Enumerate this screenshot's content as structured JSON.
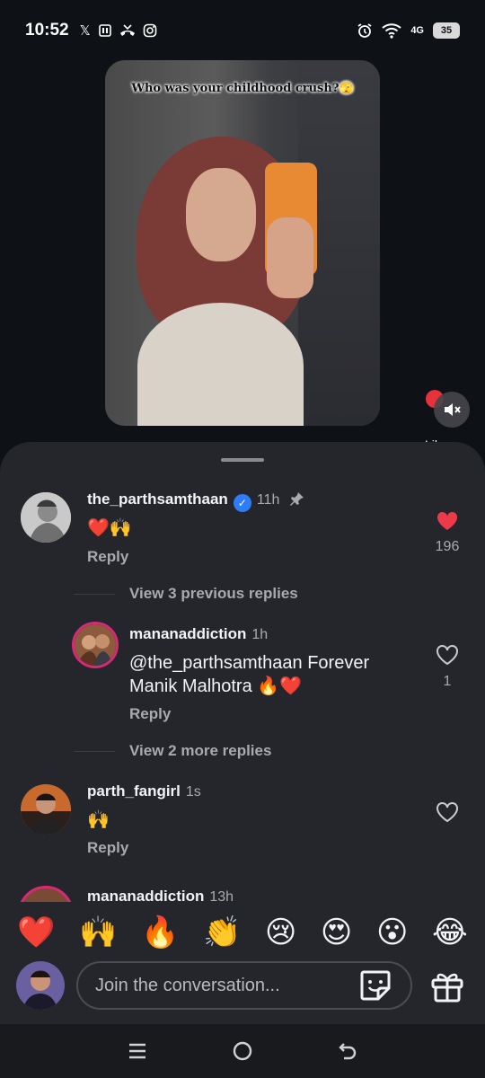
{
  "status_bar": {
    "time": "10:52",
    "left_icons": [
      "x-icon",
      "sim-icon",
      "missed-call-icon",
      "instagram-icon"
    ],
    "right_icons": [
      "alarm-icon",
      "wifi-icon",
      "4g-signal-icon"
    ],
    "network": "4G",
    "battery": "35"
  },
  "video": {
    "caption": "Who was your childhood crush?🫣"
  },
  "side_actions": {
    "likes_label": "Likes"
  },
  "comments": [
    {
      "username": "the_parthsamthaan",
      "verified": true,
      "time": "11h",
      "pinned": true,
      "text": "❤️🙌",
      "reply_label": "Reply",
      "likes": "196",
      "liked": true
    },
    {
      "view_previous": "View 3 previous replies",
      "username": "mananaddiction",
      "time": "1h",
      "text_line1": "@the_parthsamthaan Forever",
      "text_line2": "Manik Malhotra 🔥❤️",
      "reply_label": "Reply",
      "likes": "1",
      "view_more": "View 2 more replies"
    },
    {
      "username": "parth_fangirl",
      "time": "1s",
      "text": "🙌",
      "reply_label": "Reply"
    },
    {
      "username": "mananaddiction",
      "time": "13h"
    }
  ],
  "quick_emojis": [
    "❤️",
    "🙌",
    "🔥",
    "👏",
    "😢",
    "😍",
    "😮",
    "😂"
  ],
  "composer": {
    "placeholder": "Join the conversation..."
  },
  "colors": {
    "sheet_bg": "#24262b",
    "like_red": "#ed3a4b",
    "verified_blue": "#2f7df6",
    "muted_text": "#a8aab0"
  }
}
